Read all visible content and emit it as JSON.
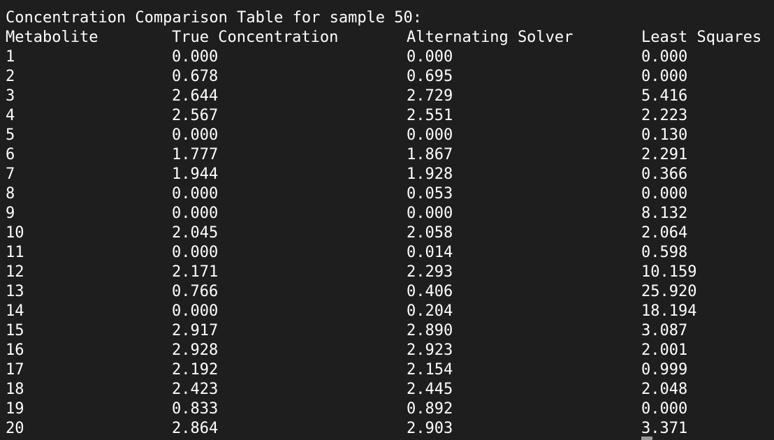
{
  "title": "Concentration Comparison Table for sample 50:",
  "headers": [
    "Metabolite",
    "True Concentration",
    "Alternating Solver",
    "Least Squares"
  ],
  "rows": [
    [
      "1",
      "0.000",
      "0.000",
      "0.000"
    ],
    [
      "2",
      "0.678",
      "0.695",
      "0.000"
    ],
    [
      "3",
      "2.644",
      "2.729",
      "5.416"
    ],
    [
      "4",
      "2.567",
      "2.551",
      "2.223"
    ],
    [
      "5",
      "0.000",
      "0.000",
      "0.130"
    ],
    [
      "6",
      "1.777",
      "1.867",
      "2.291"
    ],
    [
      "7",
      "1.944",
      "1.928",
      "0.366"
    ],
    [
      "8",
      "0.000",
      "0.053",
      "0.000"
    ],
    [
      "9",
      "0.000",
      "0.000",
      "8.132"
    ],
    [
      "10",
      "2.045",
      "2.058",
      "2.064"
    ],
    [
      "11",
      "0.000",
      "0.014",
      "0.598"
    ],
    [
      "12",
      "2.171",
      "2.293",
      "10.159"
    ],
    [
      "13",
      "0.766",
      "0.406",
      "25.920"
    ],
    [
      "14",
      "0.000",
      "0.204",
      "18.194"
    ],
    [
      "15",
      "2.917",
      "2.890",
      "3.087"
    ],
    [
      "16",
      "2.928",
      "2.923",
      "2.001"
    ],
    [
      "17",
      "2.192",
      "2.154",
      "0.999"
    ],
    [
      "18",
      "2.423",
      "2.445",
      "2.048"
    ],
    [
      "19",
      "0.833",
      "0.892",
      "0.000"
    ],
    [
      "20",
      "2.864",
      "2.903",
      "3.371"
    ]
  ],
  "colors": {
    "background": "#1e1e1e",
    "text": "#ffffff",
    "cursor": "#9a9a9a"
  }
}
